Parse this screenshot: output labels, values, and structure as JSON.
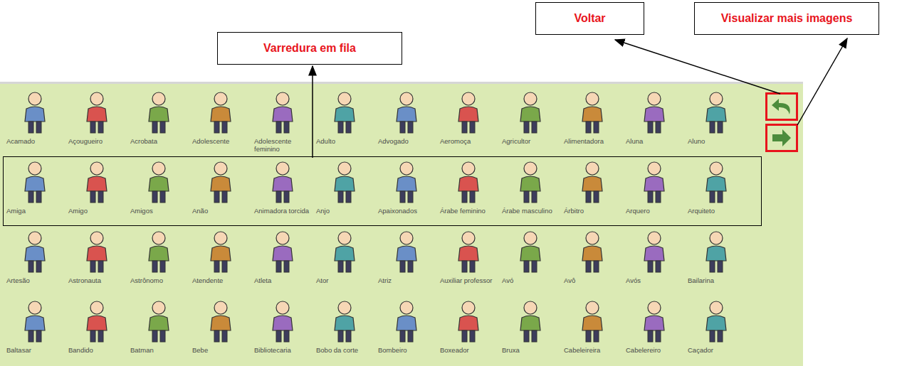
{
  "callouts": [
    {
      "label": "Varredura em fila"
    },
    {
      "label": "Voltar"
    },
    {
      "label": "Visualizar mais imagens"
    }
  ],
  "rows": [
    {
      "scanned": false,
      "items": [
        {
          "label": "Acamado"
        },
        {
          "label": "Açougueiro"
        },
        {
          "label": "Acrobata"
        },
        {
          "label": "Adolescente"
        },
        {
          "label": "Adolescente feminino"
        },
        {
          "label": "Adulto"
        },
        {
          "label": "Advogado"
        },
        {
          "label": "Aeromoça"
        },
        {
          "label": "Agricultor"
        },
        {
          "label": "Alimentadora"
        },
        {
          "label": "Aluna"
        },
        {
          "label": "Aluno"
        }
      ]
    },
    {
      "scanned": true,
      "items": [
        {
          "label": "Amiga"
        },
        {
          "label": "Amigo"
        },
        {
          "label": "Amigos"
        },
        {
          "label": "Anão"
        },
        {
          "label": "Animadora torcida"
        },
        {
          "label": "Anjo"
        },
        {
          "label": "Apaixonados"
        },
        {
          "label": "Árabe feminino"
        },
        {
          "label": "Árabe masculino"
        },
        {
          "label": "Árbitro"
        },
        {
          "label": "Arquero"
        },
        {
          "label": "Arquiteto"
        }
      ]
    },
    {
      "scanned": false,
      "items": [
        {
          "label": "Artesão"
        },
        {
          "label": "Astronauta"
        },
        {
          "label": "Astrônomo"
        },
        {
          "label": "Atendente"
        },
        {
          "label": "Atleta"
        },
        {
          "label": "Ator"
        },
        {
          "label": "Atriz"
        },
        {
          "label": "Auxiliar professor"
        },
        {
          "label": "Avó"
        },
        {
          "label": "Avô"
        },
        {
          "label": "Avós"
        },
        {
          "label": "Bailarina"
        }
      ]
    },
    {
      "scanned": false,
      "items": [
        {
          "label": "Baltasar"
        },
        {
          "label": "Bandido"
        },
        {
          "label": "Batman"
        },
        {
          "label": "Bebe"
        },
        {
          "label": "Bibliotecaria"
        },
        {
          "label": "Bobo da corte"
        },
        {
          "label": "Bombeiro"
        },
        {
          "label": "Boxeador"
        },
        {
          "label": "Bruxa"
        },
        {
          "label": "Cabeleireira"
        },
        {
          "label": "Cabelereiro"
        },
        {
          "label": "Caçador"
        }
      ]
    }
  ],
  "nav_buttons": [
    {
      "kind": "back",
      "highlighted": true
    },
    {
      "kind": "forward",
      "highlighted": true
    }
  ]
}
